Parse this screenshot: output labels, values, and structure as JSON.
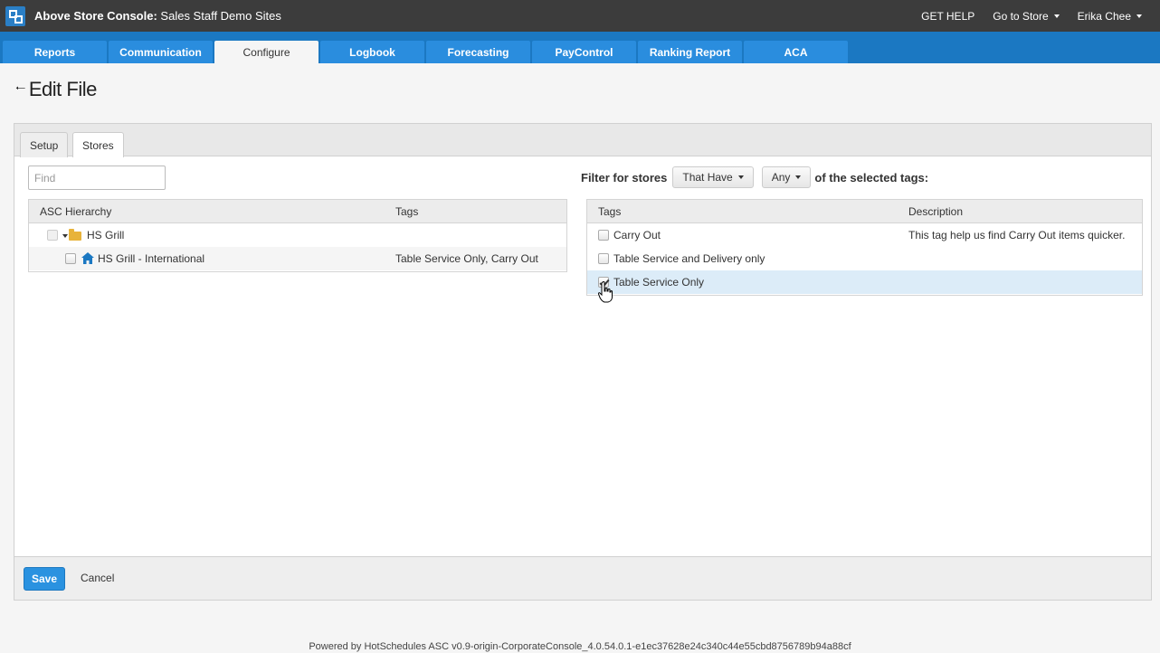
{
  "topbar": {
    "app_name": "Above Store Console:",
    "site_name": "Sales Staff Demo Sites",
    "get_help": "GET HELP",
    "go_to_store": "Go to Store",
    "user_name": "Erika Chee"
  },
  "nav": {
    "tabs": [
      {
        "label": "Reports"
      },
      {
        "label": "Communication"
      },
      {
        "label": "Configure"
      },
      {
        "label": "Logbook"
      },
      {
        "label": "Forecasting"
      },
      {
        "label": "PayControl"
      },
      {
        "label": "Ranking Report"
      },
      {
        "label": "ACA"
      }
    ],
    "active": "Configure"
  },
  "page": {
    "title": "Edit File"
  },
  "panel": {
    "tabs": [
      {
        "label": "Setup"
      },
      {
        "label": "Stores"
      }
    ],
    "active_tab": "Stores",
    "find_placeholder": "Find",
    "filter": {
      "prefix": "Filter for stores",
      "have_option": "That Have",
      "match_option": "Any",
      "suffix": "of the selected tags:"
    },
    "hierarchy": {
      "headers": {
        "name": "ASC Hierarchy",
        "tags": "Tags"
      },
      "rows": [
        {
          "name": "HS Grill",
          "tags": "",
          "type": "folder"
        },
        {
          "name": "HS Grill - International",
          "tags": "Table Service Only, Carry Out",
          "type": "store"
        }
      ]
    },
    "tags": {
      "headers": {
        "name": "Tags",
        "description": "Description"
      },
      "rows": [
        {
          "name": "Carry Out",
          "description": "This tag help us find Carry Out items quicker.",
          "checked": false
        },
        {
          "name": "Table Service and Delivery only",
          "description": "",
          "checked": false
        },
        {
          "name": "Table Service Only",
          "description": "",
          "checked": true
        }
      ]
    },
    "footer": {
      "save": "Save",
      "cancel": "Cancel"
    }
  },
  "footer": {
    "powered_by": "Powered by HotSchedules ASC v0.9-origin-CorporateConsole_4.0.54.0.1-e1ec37628e24c340c44e55cbd8756789b94a88cf"
  },
  "colors": {
    "topbar": "#3c3c3c",
    "nav": "#1b78c2",
    "nav_tab": "#2a8dde",
    "primary_button": "#2a92e0",
    "selected_row": "#dcecf8"
  }
}
